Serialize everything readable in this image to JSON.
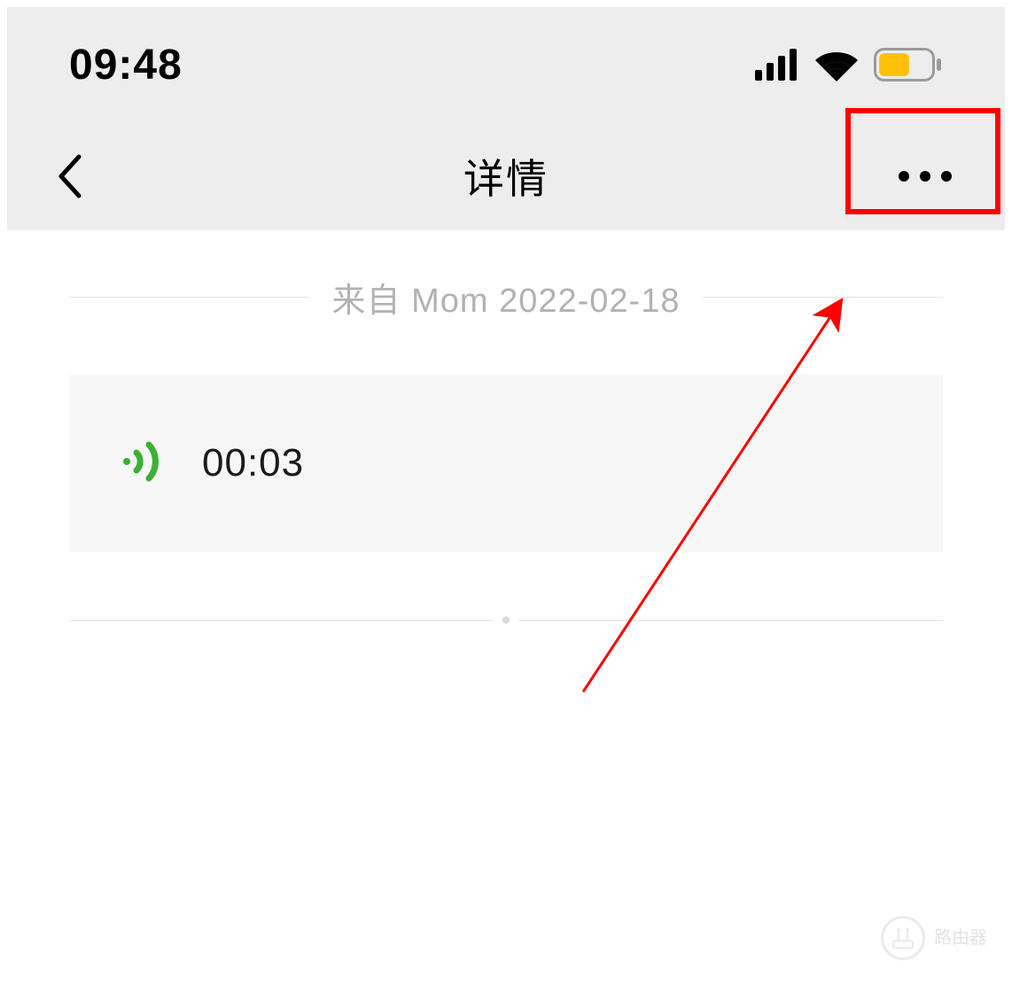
{
  "statusBar": {
    "time": "09:48"
  },
  "navBar": {
    "title": "详情"
  },
  "content": {
    "sourceLabel": "来自 Mom 2022-02-18",
    "voice": {
      "duration": "00:03"
    }
  },
  "watermark": {
    "text": "路由器"
  },
  "colors": {
    "headerBg": "#ededed",
    "voiceIcon": "#3cb034",
    "annotation": "#ff0000",
    "batteryFill": "#ffc107"
  }
}
